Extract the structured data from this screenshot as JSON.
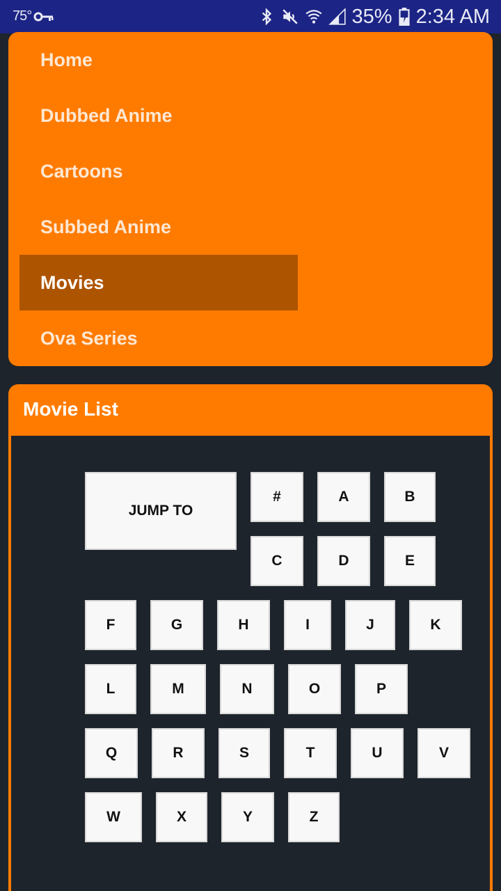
{
  "status_bar": {
    "temperature": "75°",
    "battery": "35%",
    "time": "2:34 AM",
    "icons": [
      "key-icon",
      "bluetooth-icon",
      "mute-icon",
      "wifi-icon",
      "signal-icon",
      "battery-icon"
    ]
  },
  "nav": {
    "items": [
      {
        "label": "Home",
        "active": false
      },
      {
        "label": "Dubbed Anime",
        "active": false
      },
      {
        "label": "Cartoons",
        "active": false
      },
      {
        "label": "Subbed Anime",
        "active": false
      },
      {
        "label": "Movies",
        "active": true
      },
      {
        "label": "Ova Series",
        "active": false
      }
    ]
  },
  "movie_list": {
    "title": "Movie List",
    "jump_to_label": "JUMP TO",
    "letters": [
      "#",
      "A",
      "B",
      "C",
      "D",
      "E",
      "F",
      "G",
      "H",
      "I",
      "J",
      "K",
      "L",
      "M",
      "N",
      "O",
      "P",
      "Q",
      "R",
      "S",
      "T",
      "U",
      "V",
      "W",
      "X",
      "Y",
      "Z"
    ]
  },
  "colors": {
    "accent": "#ff7b00",
    "accent_active": "#ad5400",
    "background": "#1e242c",
    "status_bar": "#1c2485"
  }
}
